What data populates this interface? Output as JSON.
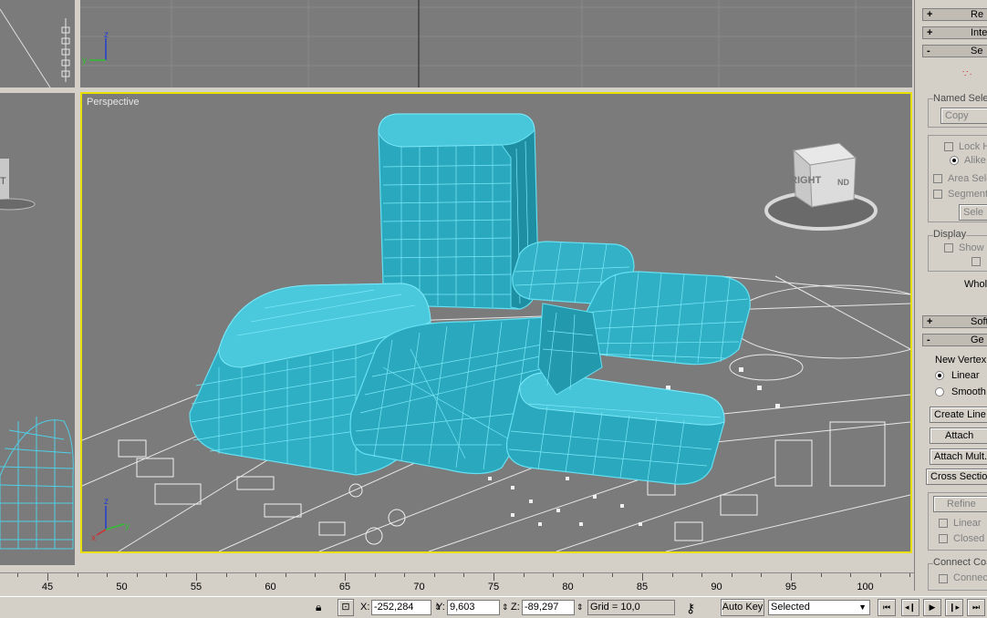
{
  "viewports": {
    "perspective_label": "Perspective",
    "viewcube_label": "RIGHT",
    "viewcube_side_label": "ND",
    "left_viewcube_fragment": "T"
  },
  "axes": {
    "x": "x",
    "y": "y",
    "z": "z"
  },
  "panel": {
    "rollouts": [
      {
        "sign": "+",
        "title": "Re"
      },
      {
        "sign": "+",
        "title": "Inter"
      },
      {
        "sign": "-",
        "title": "Se"
      },
      {
        "sign": "+",
        "title": "Soft S"
      },
      {
        "sign": "-",
        "title": "Ge"
      }
    ],
    "named_selection_label": "Named Sele",
    "copy_button": "Copy",
    "lock_label": "Lock H",
    "alike_label": "Alike",
    "area_select_label": "Area Sele",
    "segment_label": "Segment",
    "select_button": "Sele",
    "display_label": "Display",
    "show_label": "Show",
    "whole_label": "Whol",
    "new_vertex_label": "New Vertex",
    "linear_label": "Linear",
    "smooth_label": "Smooth",
    "create_line_button": "Create Line",
    "attach_button": "Attach",
    "attach_mult_button": "Attach Mult.",
    "cross_section_button": "Cross Section",
    "refine_button": "Refine",
    "refine_linear_label": "Linear",
    "refine_closed_label": "Closed",
    "connect_copy_label": "Connect Co",
    "connect_label": "Connec"
  },
  "timeline": {
    "labels": [
      "45",
      "50",
      "55",
      "60",
      "65",
      "70",
      "75",
      "80",
      "85",
      "90",
      "95",
      "100"
    ]
  },
  "status": {
    "x_label": "X:",
    "x_value": "-252,284",
    "y_label": "Y:",
    "y_value": "9,603",
    "z_label": "Z:",
    "z_value": "-89,297",
    "grid": "Grid = 10,0",
    "auto_key": "Auto Key",
    "selected_option": "Selected"
  }
}
